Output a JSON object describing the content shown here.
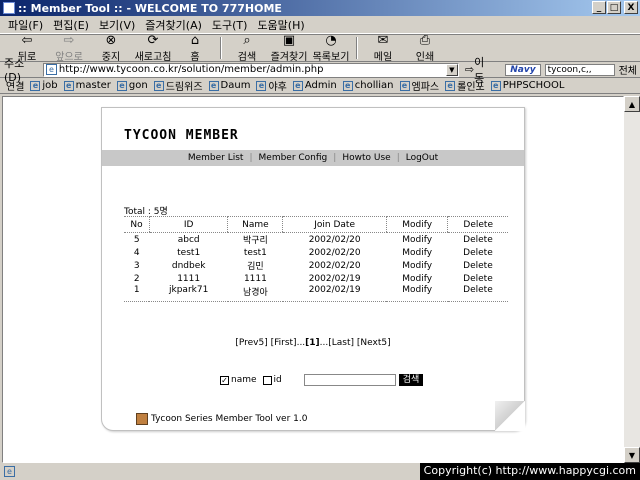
{
  "window": {
    "title": ":: Member Tool :: - WELCOME TO 777HOME",
    "min_label": "_",
    "max_label": "□",
    "close_label": "X"
  },
  "menu": [
    "파일(F)",
    "편집(E)",
    "보기(V)",
    "즐겨찾기(A)",
    "도구(T)",
    "도움말(H)"
  ],
  "toolbar": {
    "back": "뒤로",
    "forward": "앞으로",
    "stop": "중지",
    "refresh": "새로고침",
    "home": "홈",
    "search": "검색",
    "favorites": "즐겨찾기",
    "history": "목록보기",
    "mail": "메일",
    "print": "인쇄"
  },
  "address": {
    "label": "주소(D)",
    "url": "http://www.tycoon.co.kr/solution/member/admin.php",
    "go": "이동",
    "navy_brand": "Navy",
    "navy_search": "tycoon,c,,",
    "navy_all": "전체"
  },
  "links": {
    "label": "연결",
    "items": [
      "job",
      "master",
      "gon",
      "드림위즈",
      "Daum",
      "야후",
      "Admin",
      "chollian",
      "엠파스",
      "롤인포",
      "PHPSCHOOL"
    ]
  },
  "page": {
    "logo": "TYCOON MEMBER",
    "nav": [
      "Member List",
      "Member Config",
      "Howto Use",
      "LogOut"
    ],
    "total": "Total : 5명",
    "table": {
      "headers": [
        "No",
        "ID",
        "Name",
        "Join Date",
        "Modify",
        "Delete"
      ],
      "rows": [
        {
          "no": "5",
          "id": "abcd",
          "name": "박구리",
          "date": "2002/02/20",
          "modify": "Modify",
          "delete": "Delete"
        },
        {
          "no": "4",
          "id": "test1",
          "name": "test1",
          "date": "2002/02/20",
          "modify": "Modify",
          "delete": "Delete"
        },
        {
          "no": "3",
          "id": "dndbek",
          "name": "김민",
          "date": "2002/02/20",
          "modify": "Modify",
          "delete": "Delete"
        },
        {
          "no": "2",
          "id": "1111",
          "name": "1111",
          "date": "2002/02/19",
          "modify": "Modify",
          "delete": "Delete"
        },
        {
          "no": "1",
          "id": "jkpark71",
          "name": "남경아",
          "date": "2002/02/19",
          "modify": "Modify",
          "delete": "Delete"
        }
      ]
    },
    "pager": {
      "prev5": "[Prev5]",
      "first": "[First]",
      "dots1": "...",
      "current": "[1]",
      "dots2": "...",
      "last": "[Last]",
      "next5": "[Next5]"
    },
    "search": {
      "name_label": "name",
      "id_label": "id",
      "button": "검색"
    },
    "footer": "Tycoon Series Member Tool ver 1.0"
  },
  "status": {
    "copyright": "Copyright(c) http://www.happycgi.com"
  }
}
